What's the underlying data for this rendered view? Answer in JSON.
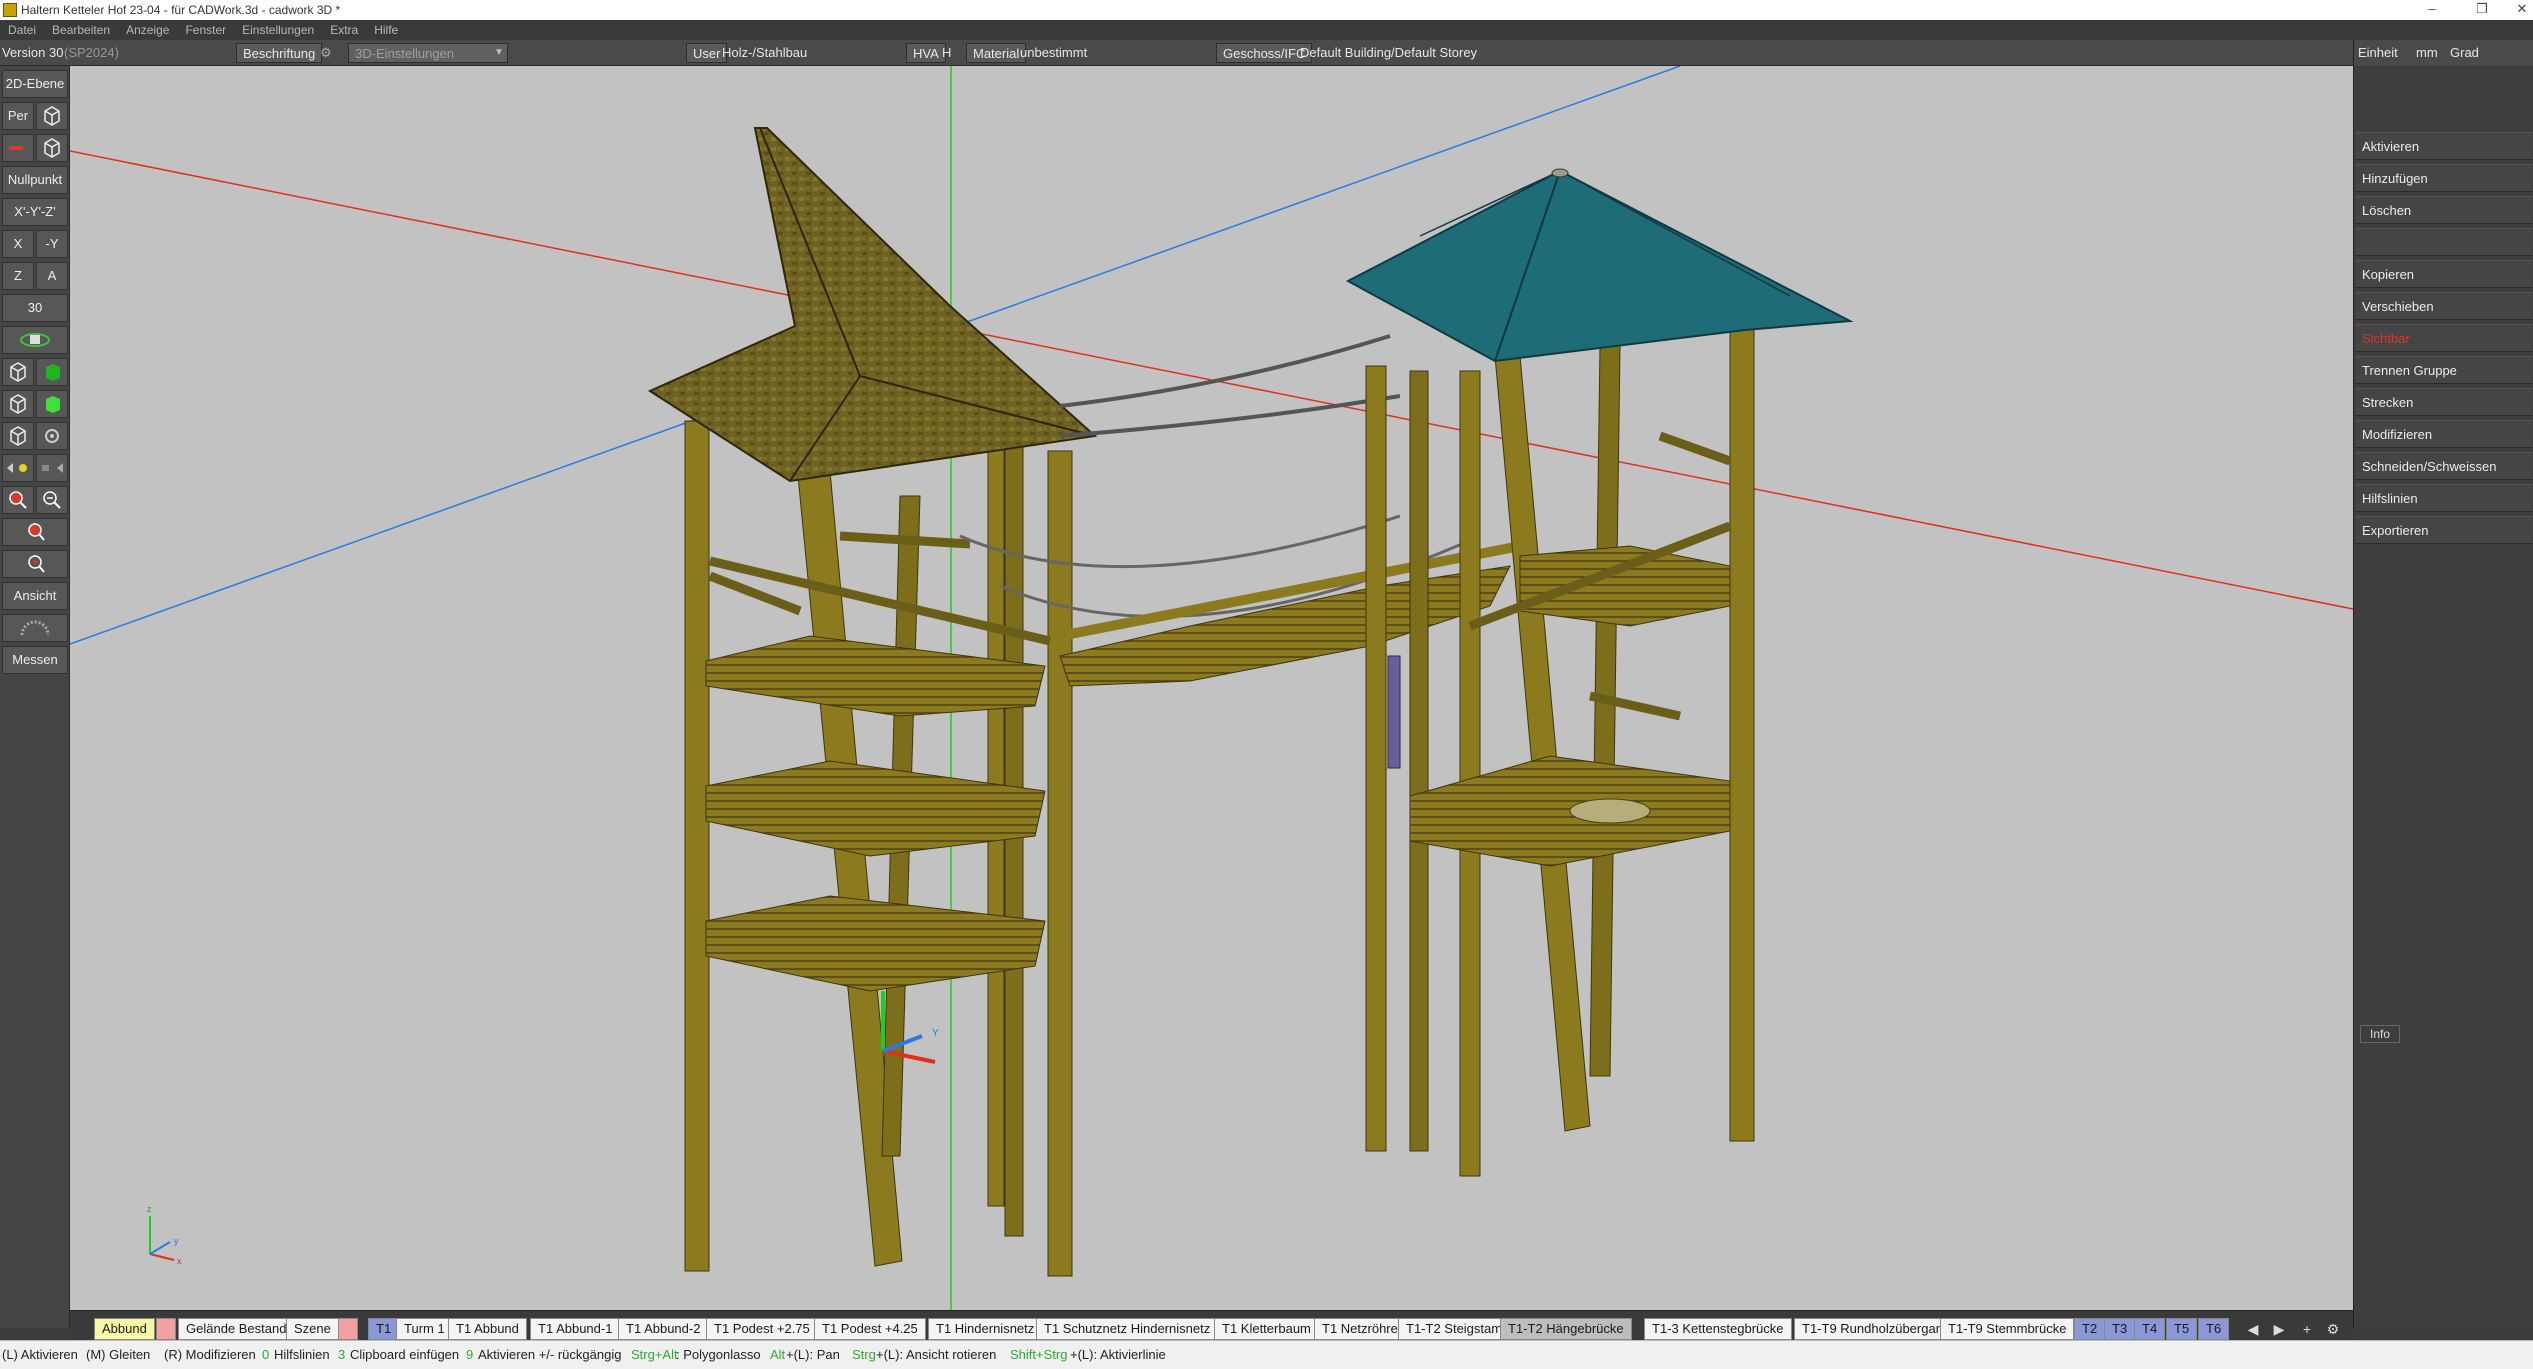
{
  "window": {
    "title": "Haltern Ketteler Hof 23-04 - für CADWork.3d - cadwork 3D *",
    "minimize": "–",
    "maximize": "❐",
    "close": "✕"
  },
  "menu": [
    "Datei",
    "Bearbeiten",
    "Anzeige",
    "Fenster",
    "Einstellungen",
    "Extra",
    "Hilfe"
  ],
  "infobar": {
    "version_label": "Version 30",
    "version_sp": "(SP2024)",
    "beschriftung": "Beschriftung",
    "settings_3d": "3D-Einstellungen",
    "user_label": "User",
    "user_value": "Holz-/Stahlbau",
    "hva": "HVA",
    "h": "H",
    "material_label": "Material",
    "material_value": "unbestimmt",
    "geschoss_label": "Geschoss/IFC",
    "geschoss_value": "Default Building/Default Storey"
  },
  "units": {
    "label": "Einheit",
    "length": "mm",
    "angle": "Grad"
  },
  "left_toolbar": {
    "ebene": "2D-Ebene",
    "per": "Per",
    "nullpunkt": "Nullpunkt",
    "xyz": "X'-Y'-Z'",
    "x": "X",
    "neg_y": "-Y",
    "z": "Z",
    "a": "A",
    "thirty": "30",
    "ansicht": "Ansicht",
    "messen": "Messen"
  },
  "right_panel": {
    "buttons": [
      "Aktivieren",
      "Hinzufügen",
      "Löschen",
      "",
      "Kopieren",
      "Verschieben",
      "Sichtbar",
      "Trennen Gruppe",
      "Strecken",
      "Modifizieren",
      "Schneiden/Schweissen",
      "Hilfslinien",
      "Exportieren"
    ],
    "info": "Info"
  },
  "tabs": [
    {
      "label": "Abbund",
      "style": "yellow"
    },
    {
      "label": "",
      "style": "pink"
    },
    {
      "label": "Gelände Bestand",
      "style": "white"
    },
    {
      "label": "Szene",
      "style": "white"
    },
    {
      "label": "",
      "style": "pink"
    },
    {
      "label": "T1",
      "style": "blue"
    },
    {
      "label": "Turm 1",
      "style": "white"
    },
    {
      "label": "T1 Abbund",
      "style": "white"
    },
    {
      "label": "T1 Abbund-1",
      "style": "white"
    },
    {
      "label": "T1 Abbund-2",
      "style": "white"
    },
    {
      "label": "T1 Podest +2.75",
      "style": "white"
    },
    {
      "label": "T1 Podest +4.25",
      "style": "white"
    },
    {
      "label": "T1 Hindernisnetz",
      "style": "white"
    },
    {
      "label": "T1 Schutznetz Hindernisnetz",
      "style": "white"
    },
    {
      "label": "T1 Kletterbaum",
      "style": "white"
    },
    {
      "label": "T1 Netzröhre",
      "style": "white"
    },
    {
      "label": "T1-T2 Steigstamm",
      "style": "white"
    },
    {
      "label": "T1-T2 Hängebrücke",
      "style": "active"
    },
    {
      "label": "T1-3 Kettenstegbrücke",
      "style": "white"
    },
    {
      "label": "T1-T9 Rundholzübergang",
      "style": "white"
    },
    {
      "label": "T1-T9 Stemmbrücke",
      "style": "white"
    },
    {
      "label": "T2",
      "style": "blue"
    },
    {
      "label": "T3",
      "style": "blue"
    },
    {
      "label": "T4",
      "style": "blue"
    },
    {
      "label": "T5",
      "style": "blue"
    },
    {
      "label": "T6",
      "style": "blue"
    }
  ],
  "tab_nav": {
    "prev": "◀",
    "next": "▶",
    "add": "+",
    "settings": "⚙"
  },
  "statusbar": {
    "s1": "(L) Aktivieren",
    "s2": "(M) Gleiten",
    "s3": "(R) Modifizieren",
    "s4k": "0",
    "s4": "Hilfslinien",
    "s5k": "3",
    "s5": "Clipboard einfügen",
    "s6k": "9",
    "s6": "Aktivieren +/- rückgängig",
    "s7k": "Strg+Alt",
    "s7": ": Polygonlasso",
    "s8k": "Alt",
    "s8": "+(L): Pan",
    "s9k": "Strg",
    "s9": "+(L): Ansicht rotieren",
    "s10k": "Shift+Strg",
    "s10": "+(L): Aktivierlinie"
  },
  "axes": {
    "x": "x",
    "y": "y",
    "z": "z",
    "Y": "Y"
  },
  "colors": {
    "viewport_bg": "#c2c2c2",
    "timber": "#8b7a1e",
    "roof_teal": "#1e6c78",
    "roof_shingle": "#6e6122",
    "axis_red": "#e0301c",
    "axis_blue": "#2a7be0",
    "axis_green": "#22cc22"
  }
}
